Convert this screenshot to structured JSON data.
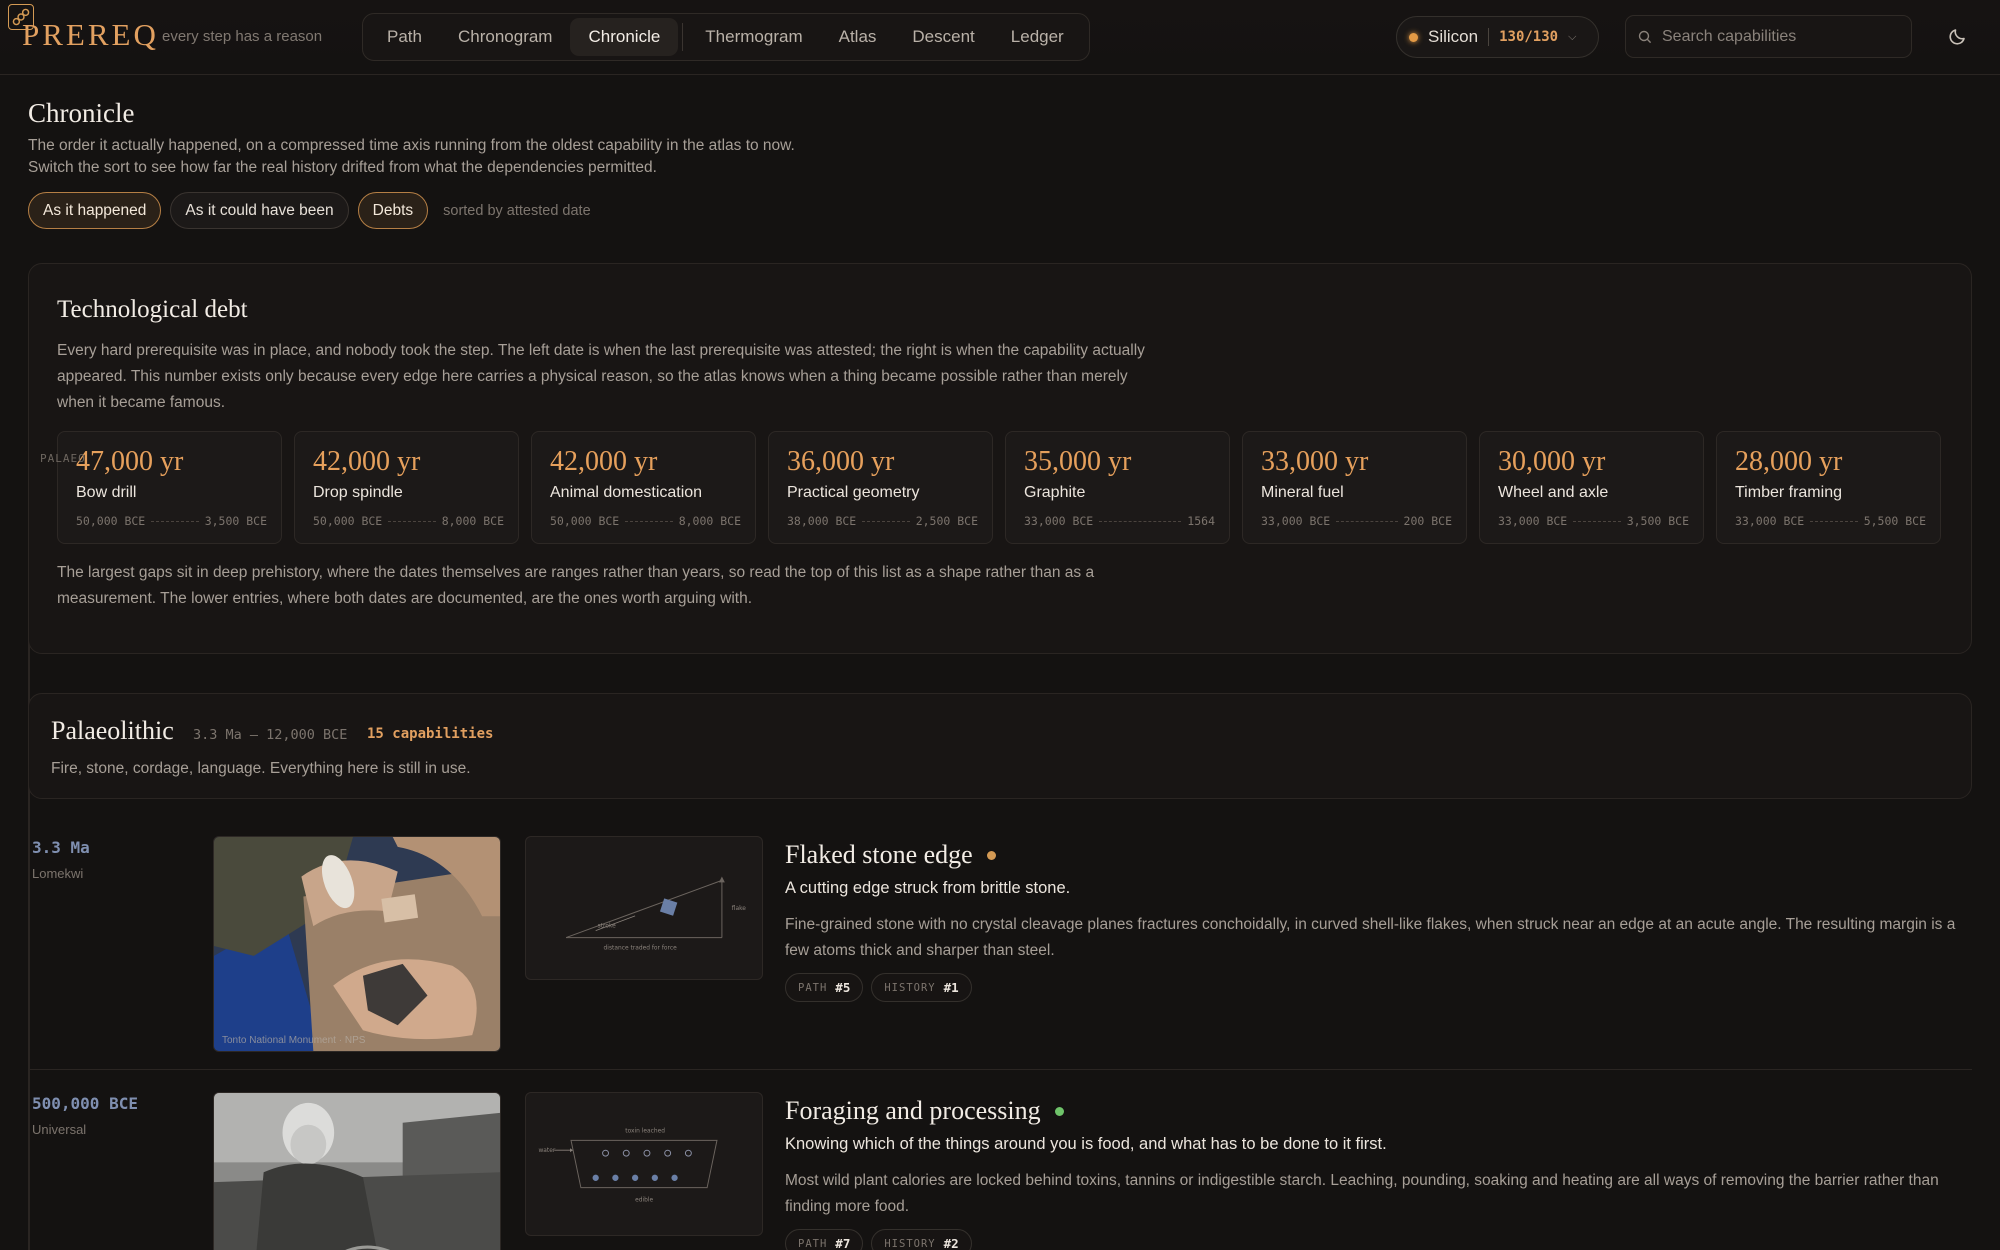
{
  "brand": {
    "name": "PREREQ",
    "tagline": "every step has a reason"
  },
  "nav": {
    "items": [
      "Path",
      "Chronogram",
      "Chronicle",
      "Thermogram",
      "Atlas",
      "Descent",
      "Ledger"
    ],
    "active": "Chronicle"
  },
  "profile": {
    "name": "Silicon",
    "count": "130/130",
    "status_color": "#e39a45"
  },
  "search": {
    "placeholder": "Search capabilities"
  },
  "page": {
    "title": "Chronicle",
    "desc_line1": "The order it actually happened, on a compressed time axis running from the oldest capability in the atlas to now.",
    "desc_line2": "Switch the sort to see how far the real history drifted from what the dependencies permitted.",
    "sort_options": [
      "As it happened",
      "As it could have been",
      "Debts"
    ],
    "active_options": [
      "As it happened",
      "Debts"
    ],
    "sort_status": "sorted by attested date"
  },
  "debt": {
    "title": "Technological debt",
    "description": "Every hard prerequisite was in place, and nobody took the step. The left date is when the last prerequisite was attested; the right is when the capability actually appeared. This number exists only because every edge here carries a physical reason, so the atlas knows when a thing became possible rather than merely when it became famous.",
    "cards": [
      {
        "years": "47,000 yr",
        "name": "Bow drill",
        "from": "50,000 BCE",
        "to": "3,500 BCE"
      },
      {
        "years": "42,000 yr",
        "name": "Drop spindle",
        "from": "50,000 BCE",
        "to": "8,000 BCE"
      },
      {
        "years": "42,000 yr",
        "name": "Animal domestication",
        "from": "50,000 BCE",
        "to": "8,000 BCE"
      },
      {
        "years": "36,000 yr",
        "name": "Practical geometry",
        "from": "38,000 BCE",
        "to": "2,500 BCE"
      },
      {
        "years": "35,000 yr",
        "name": "Graphite",
        "from": "33,000 BCE",
        "to": "1564"
      },
      {
        "years": "33,000 yr",
        "name": "Mineral fuel",
        "from": "33,000 BCE",
        "to": "200 BCE"
      },
      {
        "years": "30,000 yr",
        "name": "Wheel and axle",
        "from": "33,000 BCE",
        "to": "3,500 BCE"
      },
      {
        "years": "28,000 yr",
        "name": "Timber framing",
        "from": "33,000 BCE",
        "to": "5,500 BCE"
      }
    ],
    "footnote": "The largest gaps sit in deep prehistory, where the dates themselves are ranges rather than years, so read the top of this list as a shape rather than as a measurement. The lower entries, where both dates are documented, are the ones worth arguing with."
  },
  "side_label": "PALAEO",
  "era": {
    "title": "Palaeolithic",
    "range": "3.3 Ma – 12,000 BCE",
    "count": "15 capabilities",
    "description": "Fire, stone, cordage, language. Everything here is still in use."
  },
  "entries": [
    {
      "date": "3.3 Ma",
      "place": "Lomekwi",
      "title": "Flaked stone edge",
      "status_color": "#d49a54",
      "subtitle": "A cutting edge struck from brittle stone.",
      "body": "Fine-grained stone with no crystal cleavage planes fractures conchoidally, in curved shell-like flakes, when struck near an edge at an acute angle. The resulting margin is a few atoms thick and sharper than steel.",
      "photo_credit": "Tonto National Monument · NPS",
      "diagram_labels": {
        "stroke": "stroke",
        "flake": "flake",
        "caption": "distance traded for force"
      },
      "tags": [
        {
          "k": "PATH",
          "v": "#5"
        },
        {
          "k": "HISTORY",
          "v": "#1"
        }
      ]
    },
    {
      "date": "500,000 BCE",
      "place": "Universal",
      "title": "Foraging and processing",
      "status_color": "#6fc36a",
      "subtitle": "Knowing which of the things around you is food, and what has to be done to it first.",
      "body": "Most wild plant calories are locked behind toxins, tannins or indigestible starch. Leaching, pounding, soaking and heating are all ways of removing the barrier rather than finding more food.",
      "diagram_labels": {
        "top": "toxin leached",
        "water": "water",
        "bottom": "edible"
      },
      "tags": [
        {
          "k": "PATH",
          "v": "#7"
        },
        {
          "k": "HISTORY",
          "v": "#2"
        }
      ]
    }
  ]
}
